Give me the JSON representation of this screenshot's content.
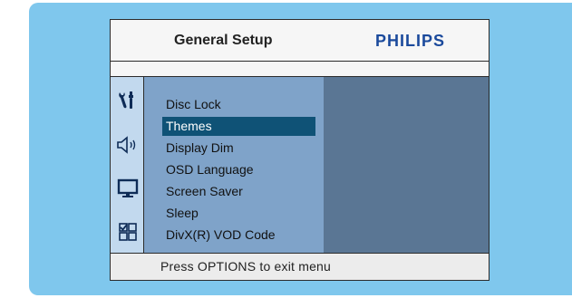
{
  "header": {
    "title": "General Setup",
    "brand": "PHILIPS"
  },
  "sidebar": {
    "icons": [
      {
        "name": "general-setup-icon"
      },
      {
        "name": "speaker-icon"
      },
      {
        "name": "monitor-icon"
      },
      {
        "name": "preferences-icon"
      }
    ]
  },
  "menu": {
    "items": [
      {
        "label": "Disc Lock"
      },
      {
        "label": "Themes",
        "selected": true
      },
      {
        "label": "Display Dim"
      },
      {
        "label": "OSD Language"
      },
      {
        "label": "Screen Saver"
      },
      {
        "label": "Sleep"
      },
      {
        "label": "DivX(R) VOD Code"
      }
    ]
  },
  "footer": {
    "hint": "Press OPTIONS to exit menu"
  },
  "colors": {
    "outer_panel": "#7fc7ed",
    "menu_background": "#7fa3c9",
    "selection": "#0f5276",
    "right_panel": "#5a7694",
    "icon_column": "#c2d9ee",
    "brand": "#1b4a9c"
  }
}
